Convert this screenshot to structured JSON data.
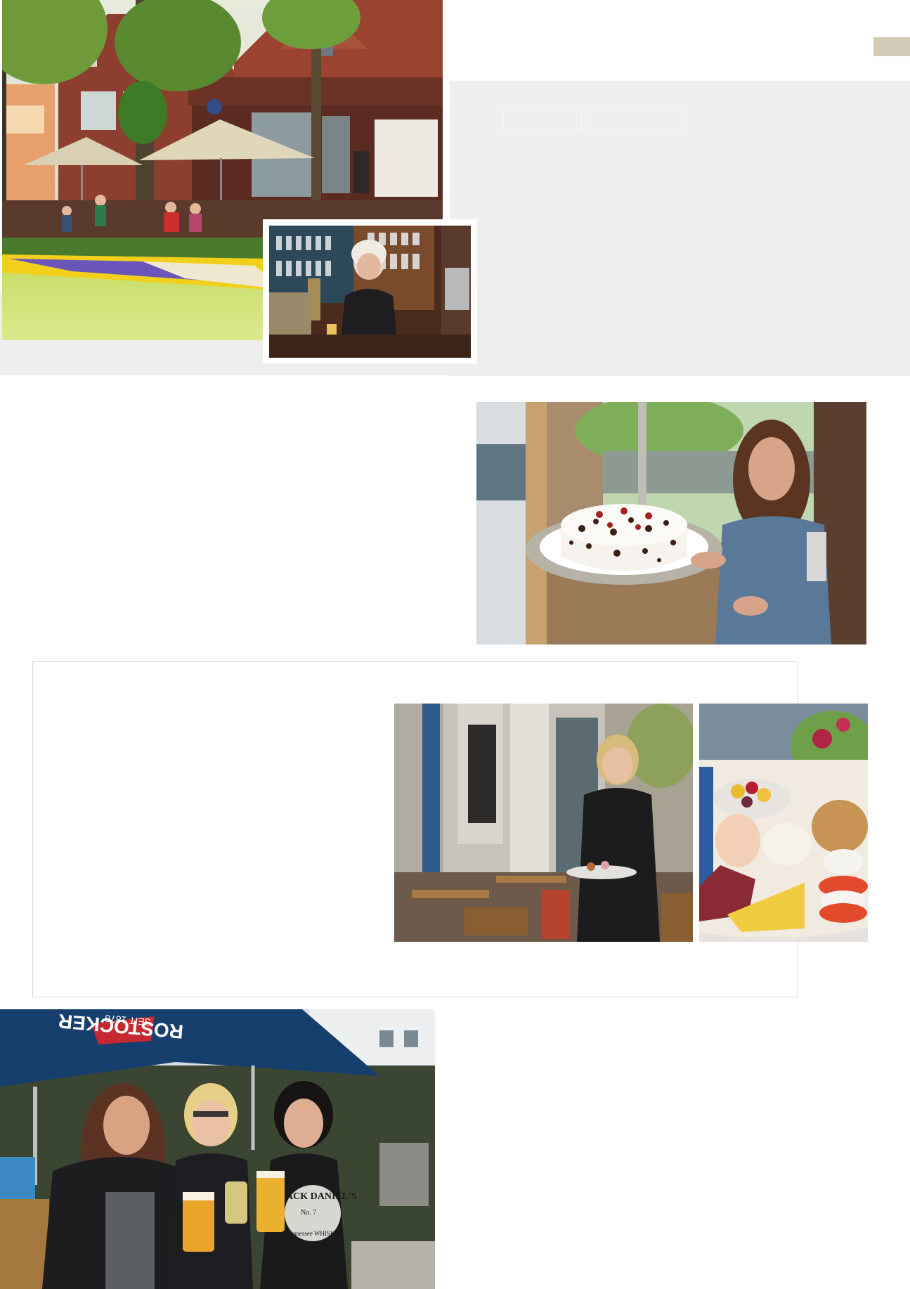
{
  "page": {
    "colors": {
      "panel": "#f0efed",
      "band": "#eeeeec",
      "accent_tab": "#d0ccb8",
      "frame_border": "#d8d8d8"
    },
    "header_tabs": [
      "",
      ""
    ]
  },
  "photos": [
    {
      "name": "street-cafe-photo",
      "subject": "brick building with parasols, flowerbed and lawn"
    },
    {
      "name": "bar-tap-photo",
      "subject": "woman pouring a beer at a bar"
    },
    {
      "name": "cake-photo",
      "subject": "woman holding a black forest cake by a window"
    },
    {
      "name": "terrace-waitress-photo",
      "subject": "waitress serving on a cafe terrace"
    },
    {
      "name": "breakfast-photo",
      "subject": "breakfast plate with egg, fruit, cheese and rolls"
    },
    {
      "name": "beer-garden-photo",
      "subject": "three women toasting under parasols",
      "umbrella_text": "ROSTOCKER",
      "umbrella_subtext": "SEIT 1878",
      "shirt_text": "JACK DANIEL'S",
      "shirt_subtext": "Tennessee WHISKEY",
      "shirt_badge": "No. 7"
    }
  ]
}
